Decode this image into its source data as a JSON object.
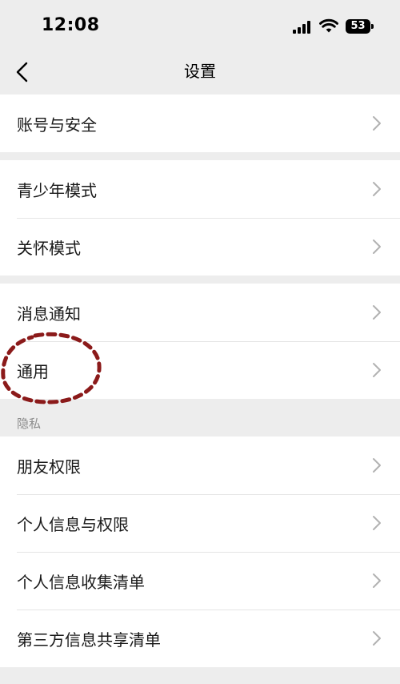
{
  "status_bar": {
    "time": "12:08",
    "battery": "53"
  },
  "nav": {
    "title": "设置"
  },
  "groups": [
    {
      "items": [
        {
          "label": "账号与安全"
        }
      ]
    },
    {
      "items": [
        {
          "label": "青少年模式"
        },
        {
          "label": "关怀模式"
        }
      ]
    },
    {
      "items": [
        {
          "label": "消息通知"
        },
        {
          "label": "通用"
        }
      ]
    },
    {
      "header": "隐私",
      "items": [
        {
          "label": "朋友权限"
        },
        {
          "label": "个人信息与权限"
        },
        {
          "label": "个人信息收集清单"
        },
        {
          "label": "第三方信息共享清单"
        }
      ]
    }
  ],
  "colors": {
    "background": "#ededed",
    "card": "#ffffff",
    "annotation": "#8b1a1a",
    "chevron": "#b2b2b2"
  }
}
